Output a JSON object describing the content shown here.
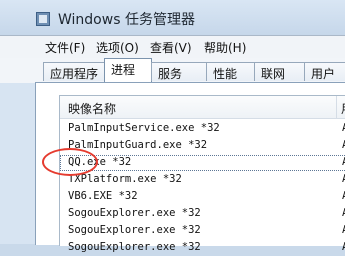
{
  "window": {
    "title": "Windows 任务管理器"
  },
  "menu": [
    "文件(F)",
    "选项(O)",
    "查看(V)",
    "帮助(H)"
  ],
  "tabs": [
    {
      "label": "应用程序",
      "active": false
    },
    {
      "label": "进程",
      "active": true
    },
    {
      "label": "服务",
      "active": false
    },
    {
      "label": "性能",
      "active": false
    },
    {
      "label": "联网",
      "active": false
    },
    {
      "label": "用户",
      "active": false
    }
  ],
  "process_list": {
    "column_image_name": "映像名称",
    "column_user": "用",
    "rows": [
      {
        "name": "PalmInputService.exe *32",
        "user": "A",
        "selected": false
      },
      {
        "name": "PalmInputGuard.exe *32",
        "user": "A",
        "selected": false
      },
      {
        "name": "QQ.exe *32",
        "user": "A",
        "selected": true
      },
      {
        "name": "TXPlatform.exe *32",
        "user": "A",
        "selected": false
      },
      {
        "name": "VB6.EXE *32",
        "user": "A",
        "selected": false
      },
      {
        "name": "SogouExplorer.exe *32",
        "user": "A",
        "selected": false
      },
      {
        "name": "SogouExplorer.exe *32",
        "user": "A",
        "selected": false
      },
      {
        "name": "SogouExplorer.exe *32",
        "user": "A",
        "selected": false
      }
    ]
  },
  "accent": {
    "highlight_circle": "#e53b2f"
  }
}
